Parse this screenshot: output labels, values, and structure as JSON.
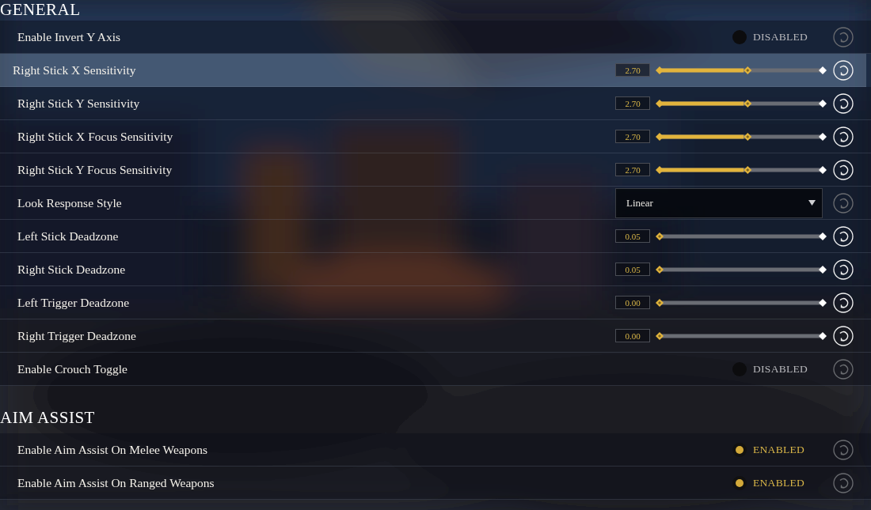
{
  "sections": [
    {
      "title": "GENERAL",
      "rows": [
        {
          "kind": "toggle",
          "label": "Enable Invert Y Axis",
          "enabled": false,
          "value": "DISABLED",
          "selected": false,
          "resettable": false
        },
        {
          "kind": "slider",
          "label": "Right Stick X Sensitivity",
          "value": "2.70",
          "level": 0.54,
          "selected": true,
          "resettable": true
        },
        {
          "kind": "slider",
          "label": "Right Stick Y Sensitivity",
          "value": "2.70",
          "level": 0.54,
          "selected": false,
          "resettable": true
        },
        {
          "kind": "slider",
          "label": "Right Stick X Focus Sensitivity",
          "value": "2.70",
          "level": 0.54,
          "selected": false,
          "resettable": true
        },
        {
          "kind": "slider",
          "label": "Right Stick Y Focus Sensitivity",
          "value": "2.70",
          "level": 0.54,
          "selected": false,
          "resettable": true
        },
        {
          "kind": "dropdown",
          "label": "Look Response Style",
          "value": "Linear",
          "selected": false,
          "resettable": false
        },
        {
          "kind": "slider",
          "label": "Left Stick Deadzone",
          "value": "0.05",
          "level": 0,
          "selected": false,
          "resettable": true
        },
        {
          "kind": "slider",
          "label": "Right Stick Deadzone",
          "value": "0.05",
          "level": 0,
          "selected": false,
          "resettable": true
        },
        {
          "kind": "slider",
          "label": "Left Trigger Deadzone",
          "value": "0.00",
          "level": 0,
          "selected": false,
          "resettable": true
        },
        {
          "kind": "slider",
          "label": "Right Trigger Deadzone",
          "value": "0.00",
          "level": 0,
          "selected": false,
          "resettable": true
        },
        {
          "kind": "toggle",
          "label": "Enable Crouch Toggle",
          "enabled": false,
          "value": "DISABLED",
          "selected": false,
          "resettable": false
        }
      ]
    },
    {
      "title": "AIM ASSIST",
      "rows": [
        {
          "kind": "toggle",
          "label": "Enable Aim Assist On Melee Weapons",
          "enabled": true,
          "value": "ENABLED",
          "selected": false,
          "resettable": false
        },
        {
          "kind": "toggle",
          "label": "Enable Aim Assist On Ranged Weapons",
          "enabled": true,
          "value": "ENABLED",
          "selected": false,
          "resettable": false
        }
      ]
    }
  ]
}
